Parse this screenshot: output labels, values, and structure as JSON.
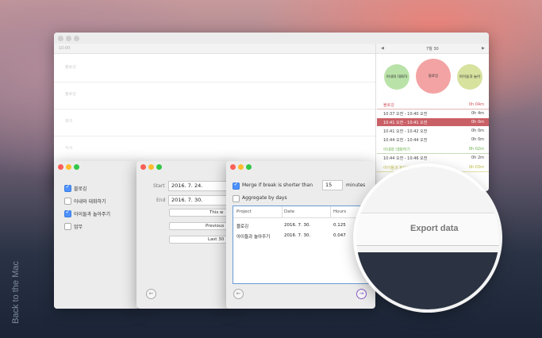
{
  "main": {
    "time_start": "10:00",
    "date_header": "7월 30",
    "nav_prev": "◀",
    "nav_next": "▶",
    "row_labels": [
      "블로깅",
      "블로깅",
      "회의",
      "식사"
    ],
    "circles": [
      {
        "label": "아내와 대화하",
        "color": "#b9e2a8"
      },
      {
        "label": "블로깅",
        "color": "#f3a3a3"
      },
      {
        "label": "아이들과 놀아",
        "color": "#d6e29e"
      }
    ],
    "groups": [
      {
        "name": "블로깅",
        "total": "0h 04m",
        "color": "#d0525c"
      },
      {
        "name": "아내와 대화하기",
        "total": "0h 02m",
        "color": "#6cae4c"
      },
      {
        "name": "아이들과 놀아주기",
        "total": "0h 03m",
        "color": "#b8b740"
      }
    ],
    "entries": [
      {
        "range": "10:37 오전 - 10:40 오전",
        "dur": "0h 4m",
        "selected": false
      },
      {
        "range": "10:41 오전 - 10:41 오전",
        "dur": "0h 0m",
        "selected": true
      },
      {
        "range": "10:41 오전 - 10:42 오전",
        "dur": "0h 0m",
        "selected": false
      },
      {
        "range": "10:44 오전 - 10:44 오전",
        "dur": "0h 0m",
        "selected": false
      },
      {
        "range": "10:44 오전 - 10:46 오전",
        "dur": "0h 2m",
        "selected": false
      }
    ]
  },
  "projects_dialog": {
    "items": [
      {
        "label": "블로깅",
        "checked": true
      },
      {
        "label": "아내와 대화하기",
        "checked": false
      },
      {
        "label": "아이들과 놀아주기",
        "checked": true
      },
      {
        "label": "업무",
        "checked": false
      }
    ]
  },
  "range_dialog": {
    "start_label": "Start",
    "start_value": "2016.  7. 24.",
    "end_label": "End",
    "end_value": "2016.  7. 30.",
    "buttons": [
      "This w",
      "Previous",
      "Last 30"
    ],
    "back_icon": "←"
  },
  "export_dialog": {
    "merge_label": "Merge if break is shorter than",
    "merge_value": "15",
    "merge_unit": "minutes",
    "aggregate_label": "Aggregate by days",
    "columns": [
      "Project",
      "Date",
      "Hours"
    ],
    "rows": [
      {
        "project": "블로깅",
        "date": "2016. 7. 30.",
        "hours": "0.125"
      },
      {
        "project": "아이들과 놀아주기",
        "date": "2016. 7. 30.",
        "hours": "0.047"
      }
    ],
    "back_icon": "←",
    "next_icon": "→"
  },
  "lens": {
    "export_label": "Export data"
  },
  "side_text": "Back to the Mac",
  "colors": {
    "traffic_red": "#fc5f57",
    "traffic_yellow": "#fdbc2e",
    "traffic_green": "#33c748",
    "accent": "#4d90fe"
  }
}
